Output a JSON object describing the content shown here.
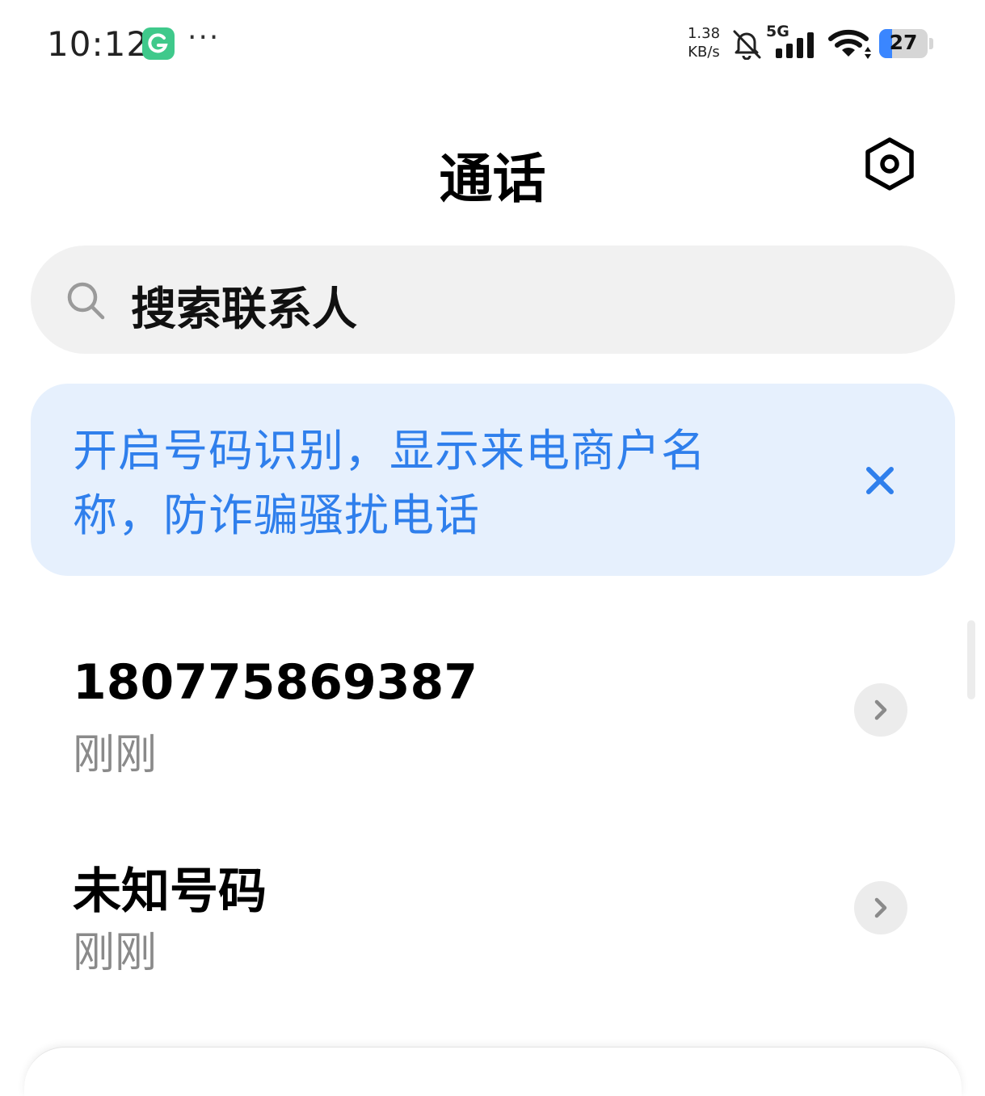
{
  "status_bar": {
    "time": "10:12",
    "more": "···",
    "net_speed_value": "1.38",
    "net_speed_unit": "KB/s",
    "network_type": "5G",
    "battery_level": "27",
    "battery_fraction": 0.27,
    "icons": [
      "app-notification-icon",
      "bell-off-icon",
      "cellular-signal-icon",
      "wifi-icon",
      "battery-icon"
    ]
  },
  "header": {
    "title": "通话",
    "settings_icon": "settings-hexagon-icon"
  },
  "search": {
    "placeholder": "搜索联系人"
  },
  "banner": {
    "text": "开启号码识别，显示来电商户名称，防诈骗骚扰电话",
    "close_icon": "close-icon",
    "color": "#2f7fec",
    "background": "#e6f0fd"
  },
  "calls": [
    {
      "title": "18077586938​7",
      "time": "刚刚"
    },
    {
      "title": "未知号码",
      "time": "刚刚"
    }
  ]
}
